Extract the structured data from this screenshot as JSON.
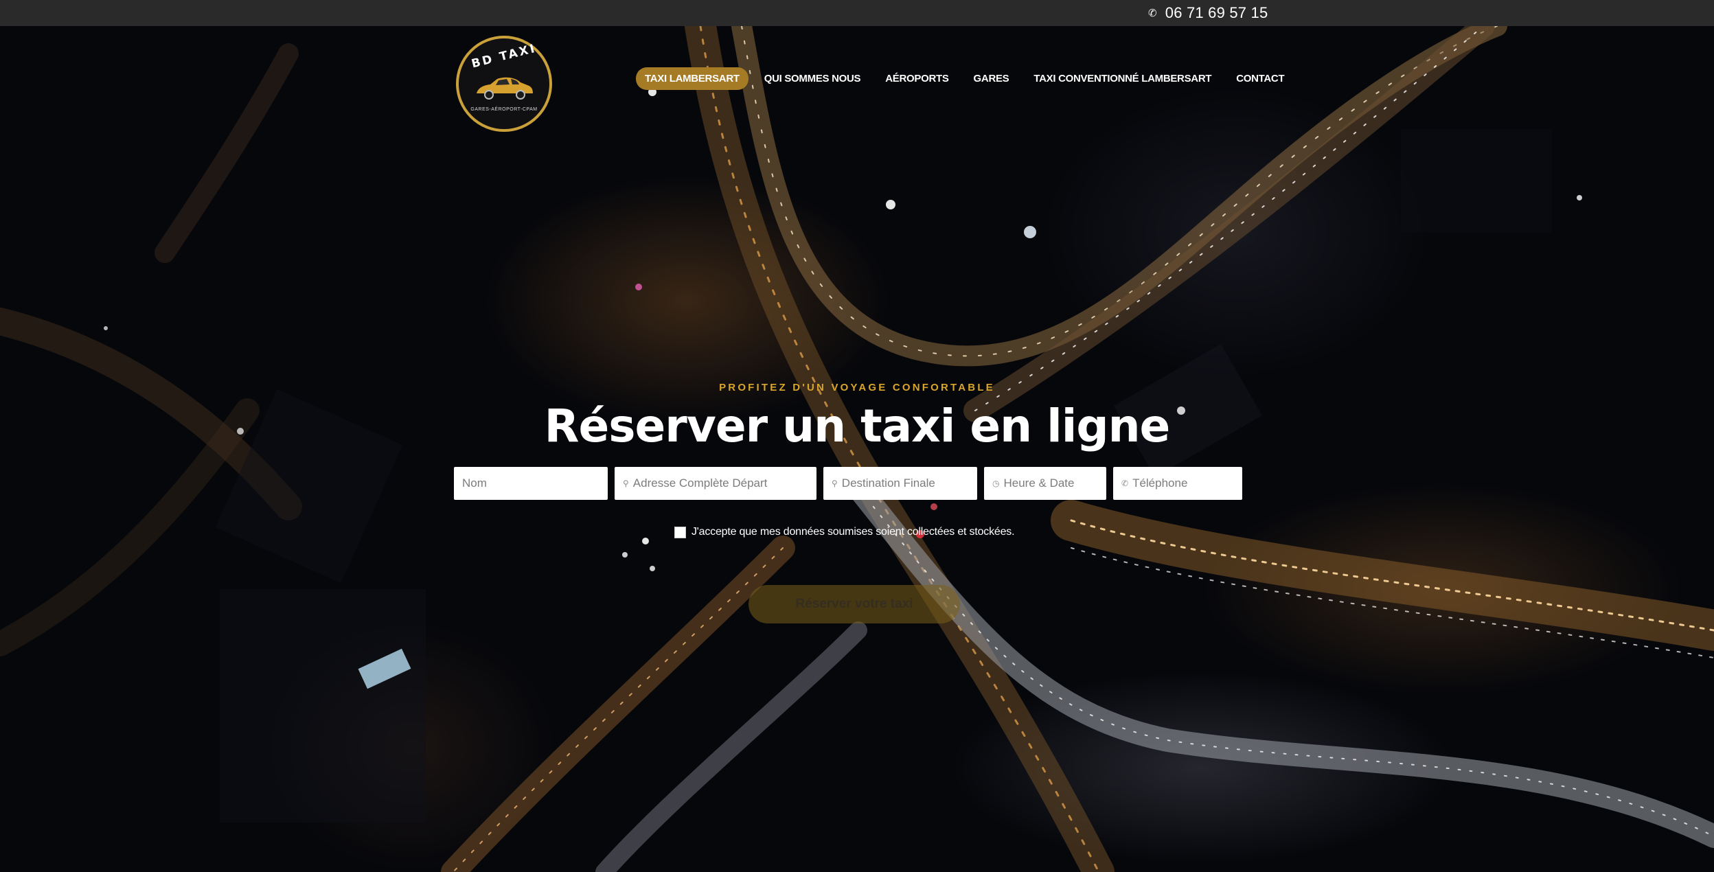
{
  "topbar": {
    "phone_icon": "phone-icon",
    "phone": "06 71 69 57 15"
  },
  "logo": {
    "title": "BD TAXI",
    "subtitle": "GARES-AÉROPORT-CPAM",
    "accent_color": "#c9a03a"
  },
  "nav": {
    "items": [
      {
        "label": "TAXI LAMBERSART",
        "active": true
      },
      {
        "label": "QUI SOMMES NOUS",
        "active": false
      },
      {
        "label": "AÉROPORTS",
        "active": false
      },
      {
        "label": "GARES",
        "active": false
      },
      {
        "label": "TAXI CONVENTIONNÉ LAMBERSART",
        "active": false
      },
      {
        "label": "CONTACT",
        "active": false
      }
    ],
    "active_color": "#a57b25"
  },
  "hero": {
    "kicker": "PROFITEZ D'UN VOYAGE CONFORTABLE",
    "title": "Réserver un taxi en ligne",
    "kicker_color": "#d9a52a"
  },
  "form": {
    "fields": [
      {
        "name": "nom",
        "icon": "",
        "placeholder": "Nom",
        "value": ""
      },
      {
        "name": "depart",
        "icon": "map-pin-icon",
        "placeholder": "Adresse Complète Départ",
        "value": ""
      },
      {
        "name": "destination",
        "icon": "map-pin-icon",
        "placeholder": "Destination Finale",
        "value": ""
      },
      {
        "name": "datetime",
        "icon": "clock-icon",
        "placeholder": "Heure & Date",
        "value": ""
      },
      {
        "name": "telephone",
        "icon": "phone-icon",
        "placeholder": "Téléphone",
        "value": ""
      }
    ],
    "consent_label": "J'accepte que mes données soumises soient collectées et stockées.",
    "consent_checked": false,
    "submit_label": "Réserver votre taxi"
  }
}
